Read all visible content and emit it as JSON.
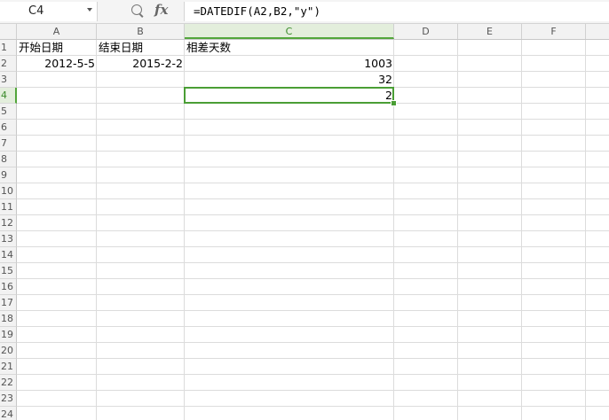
{
  "formula_bar": {
    "name_box": "C4",
    "formula": "=DATEDIF(A2,B2,\"y\")",
    "icons": [
      "zoom-icon",
      "fx-icon"
    ],
    "fx_label": "fx"
  },
  "sheet": {
    "columns": [
      "A",
      "B",
      "C",
      "D",
      "E",
      "F"
    ],
    "active_column": "C",
    "rows": [
      "1",
      "2",
      "3",
      "4",
      "5",
      "6",
      "7",
      "8",
      "9",
      "10",
      "11",
      "12",
      "13",
      "14",
      "15",
      "16",
      "17",
      "18",
      "19",
      "20",
      "21",
      "22",
      "23",
      "24"
    ],
    "active_row": "4",
    "cells": {
      "A1": "开始日期",
      "B1": "结束日期",
      "C1": "相差天数",
      "A2": "2012-5-5",
      "B2": "2015-2-2",
      "C2": "1003",
      "C3": "32",
      "C4": "2"
    }
  },
  "colors": {
    "accent": "#4a9e35",
    "header_bg": "#f2f2f2",
    "gridline": "#dcdcdc"
  }
}
